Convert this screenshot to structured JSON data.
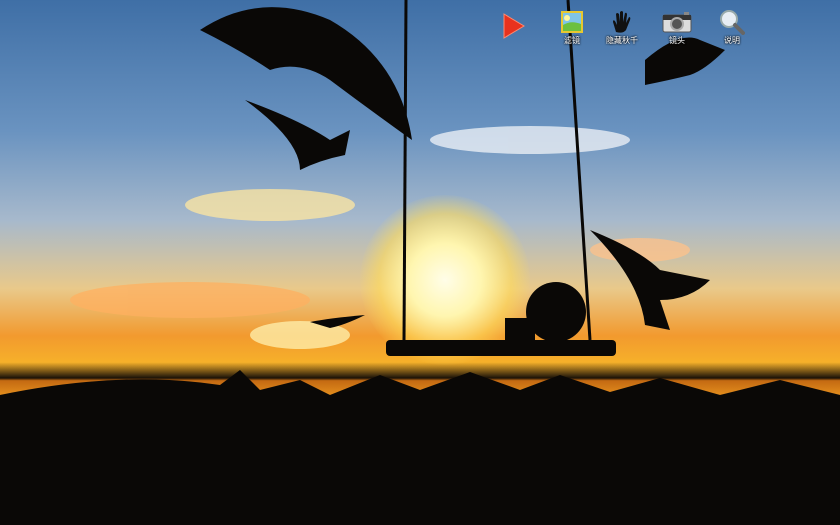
{
  "toolbar": {
    "play": {
      "icon": "play-icon"
    },
    "items": [
      {
        "label": "滤镜",
        "icon": "picture-icon"
      },
      {
        "label": "隐藏秋千",
        "icon": "hand-icon"
      },
      {
        "label": "镜头",
        "icon": "camera-icon"
      },
      {
        "label": "说明",
        "icon": "magnifier-icon"
      }
    ]
  },
  "colors": {
    "play": "#e8321e",
    "sky_top": "#3f6fa6",
    "sun": "#fff6b0"
  }
}
